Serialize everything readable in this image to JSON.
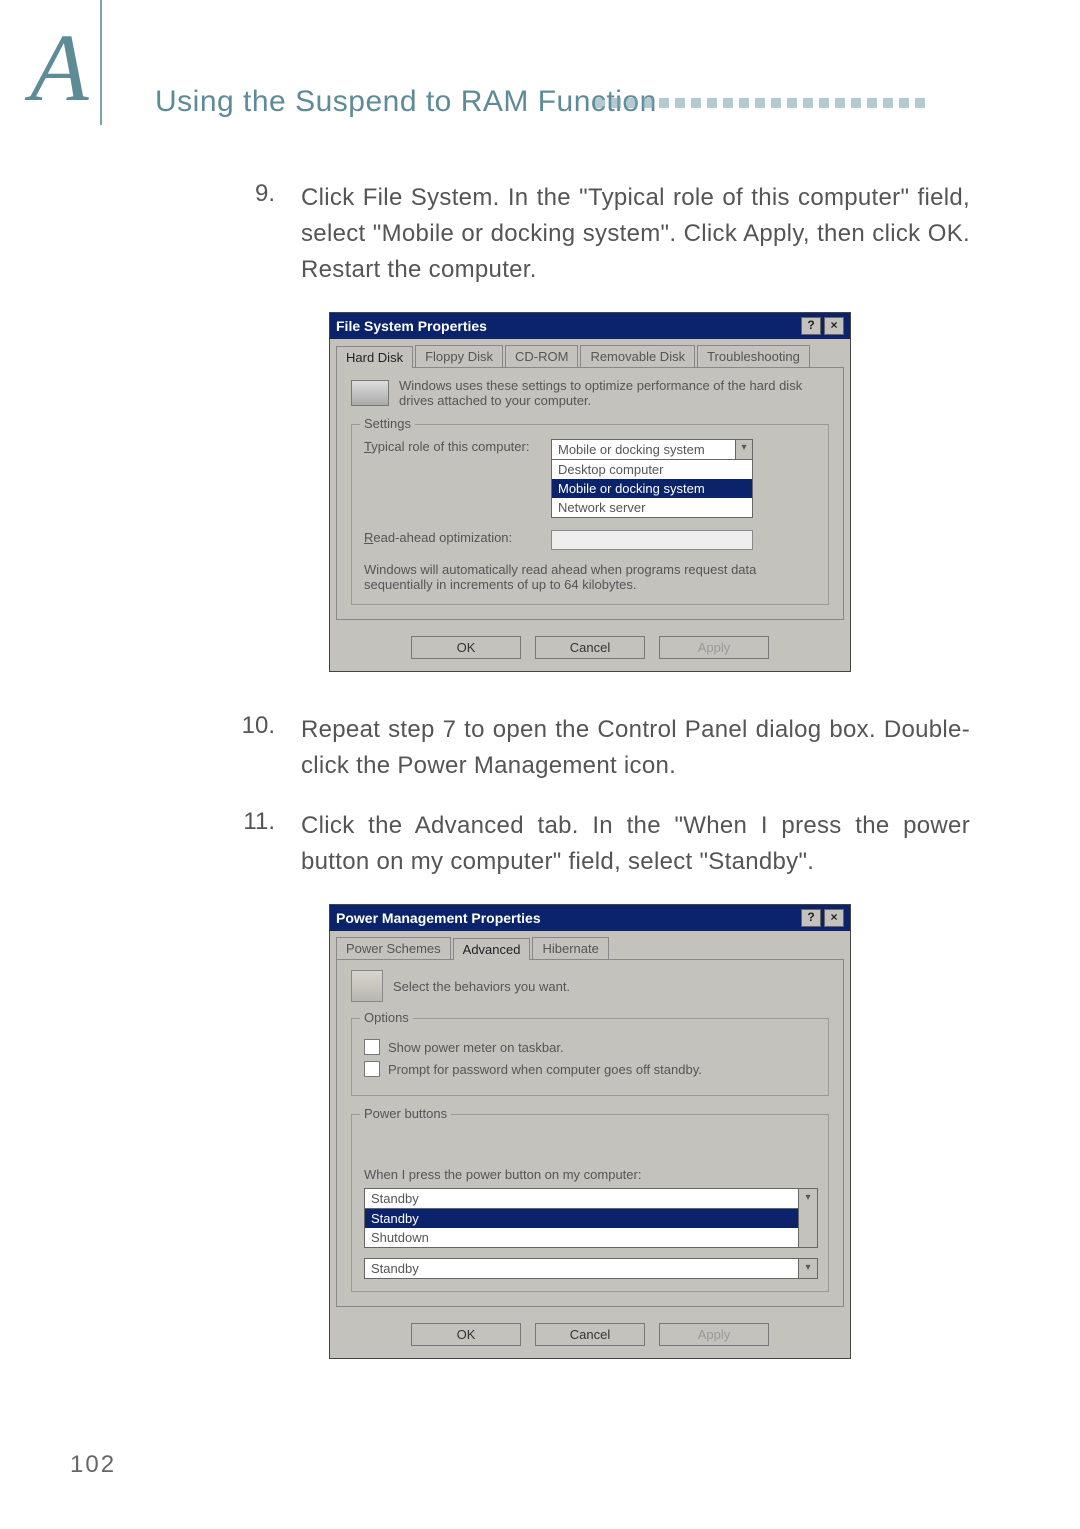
{
  "header": {
    "appendix_mark": "A",
    "section_title": "Using the Suspend to RAM Function"
  },
  "steps": [
    {
      "num": "9.",
      "text": "Click File System. In the \"Typical role of this computer\" field, select \"Mobile or docking system\". Click Apply, then click OK. Restart the computer."
    },
    {
      "num": "10.",
      "text": "Repeat step 7 to open the Control Panel dialog box. Double-click the Power Management icon."
    },
    {
      "num": "11.",
      "text": "Click the Advanced tab. In the \"When I press the power button on my computer\" field, select \"Standby\"."
    }
  ],
  "fig1": {
    "title": "File System Properties",
    "help_btn": "?",
    "close_btn": "×",
    "tabs": [
      "Hard Disk",
      "Floppy Disk",
      "CD-ROM",
      "Removable Disk",
      "Troubleshooting"
    ],
    "intro": "Windows uses these settings to optimize performance of the hard disk drives attached to your computer.",
    "group_label": "Settings",
    "typical_label_pre": "T",
    "typical_label_rest": "ypical role of this computer:",
    "combo_selected": "Mobile or docking system",
    "combo_opts": [
      "Desktop computer",
      "Mobile or docking system",
      "Network server"
    ],
    "readahead_label_pre": "R",
    "readahead_label_rest": "ead-ahead optimization:",
    "note": "Windows will automatically read ahead when programs request data sequentially in increments of up to 64 kilobytes.",
    "btns": {
      "ok": "OK",
      "cancel": "Cancel",
      "apply": "Apply"
    }
  },
  "fig2": {
    "title": "Power Management Properties",
    "help_btn": "?",
    "close_btn": "×",
    "tabs": [
      "Power Schemes",
      "Advanced",
      "Hibernate"
    ],
    "intro": "Select the behaviors you want.",
    "options_label": "Options",
    "chk1": "Show power meter on taskbar.",
    "chk2": "Prompt for password when computer goes off standby.",
    "powerbtn_label": "Power buttons",
    "prompt": "When I press the power button on my computer:",
    "dd1_selected": "Standby",
    "dd1_opts": [
      "Standby",
      "Shutdown"
    ],
    "dd2_selected": "Standby",
    "btns": {
      "ok": "OK",
      "cancel": "Cancel",
      "apply": "Apply"
    }
  },
  "footer": {
    "page_no": "102"
  }
}
